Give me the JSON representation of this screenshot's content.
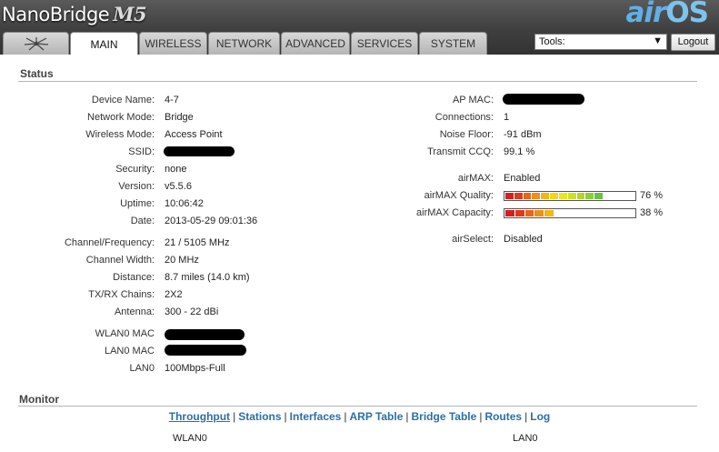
{
  "header": {
    "device_name": "NanoBridge",
    "device_model": "M5",
    "brand_air": "air",
    "brand_os": "OS"
  },
  "tabs": [
    {
      "label": ""
    },
    {
      "label": "MAIN"
    },
    {
      "label": "WIRELESS"
    },
    {
      "label": "NETWORK"
    },
    {
      "label": "ADVANCED"
    },
    {
      "label": "SERVICES"
    },
    {
      "label": "SYSTEM"
    }
  ],
  "tools": {
    "selected": "Tools:",
    "logout": "Logout"
  },
  "status": {
    "title": "Status",
    "left": [
      {
        "label": "Device Name:",
        "value": "4-7"
      },
      {
        "label": "Network Mode:",
        "value": "Bridge"
      },
      {
        "label": "Wireless Mode:",
        "value": "Access Point"
      },
      {
        "label": "SSID:",
        "value": ""
      },
      {
        "label": "Security:",
        "value": "none"
      },
      {
        "label": "Version:",
        "value": "v5.5.6"
      },
      {
        "label": "Uptime:",
        "value": "10:06:42"
      },
      {
        "label": "Date:",
        "value": "2013-05-29 09:01:36"
      },
      {
        "label": "Channel/Frequency:",
        "value": "21 / 5105 MHz"
      },
      {
        "label": "Channel Width:",
        "value": "20 MHz"
      },
      {
        "label": "Distance:",
        "value": "8.7 miles (14.0 km)"
      },
      {
        "label": "TX/RX Chains:",
        "value": "2X2"
      },
      {
        "label": "Antenna:",
        "value": "300 - 22 dBi"
      },
      {
        "label": "WLAN0 MAC",
        "value": ""
      },
      {
        "label": "LAN0 MAC",
        "value": ""
      },
      {
        "label": "LAN0",
        "value": "100Mbps-Full"
      }
    ],
    "right": [
      {
        "label": "AP MAC:",
        "value": ""
      },
      {
        "label": "Connections:",
        "value": "1"
      },
      {
        "label": "Noise Floor:",
        "value": "-91 dBm"
      },
      {
        "label": "Transmit CCQ:",
        "value": "99.1 %"
      },
      {
        "label": "airMAX:",
        "value": "Enabled"
      },
      {
        "label": "airMAX Quality:",
        "value": "76 %",
        "level": 0.76
      },
      {
        "label": "airMAX Capacity:",
        "value": "38 %",
        "level": 0.38
      },
      {
        "label": "airSelect:",
        "value": "Disabled"
      }
    ],
    "bar_colors": [
      "#d42020",
      "#e03a1c",
      "#e8651a",
      "#ef8f1a",
      "#f2b51a",
      "#f5d51c",
      "#e9e51f",
      "#d0e024",
      "#b2d62c",
      "#8fcb38",
      "#6fbf46",
      "#55b253",
      "#45a55e",
      "#3c9866"
    ]
  },
  "monitor": {
    "title": "Monitor",
    "links": [
      "Throughput",
      "Stations",
      "Interfaces",
      "ARP Table",
      "Bridge Table",
      "Routes",
      "Log"
    ],
    "iface_left": "WLAN0",
    "iface_right": "LAN0"
  }
}
